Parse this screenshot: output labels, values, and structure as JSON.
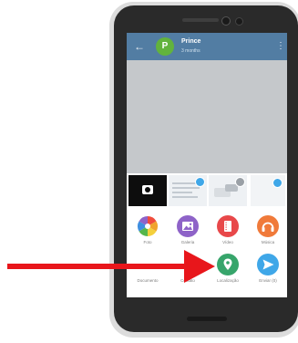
{
  "chat": {
    "name": "Prince",
    "status": "3 months"
  },
  "attach_menu": {
    "items": [
      {
        "label": "Foto",
        "icon": "photo-pinwheel-icon",
        "color": "#f0a32c"
      },
      {
        "label": "Galeria",
        "icon": "gallery-icon",
        "color": "#8e63c8"
      },
      {
        "label": "Vídeo",
        "icon": "video-icon",
        "color": "#e8484a"
      },
      {
        "label": "Música",
        "icon": "headphones-icon",
        "color": "#f07a3a"
      },
      {
        "label": "Documento",
        "icon": "file-icon",
        "color": "#7aa6d6"
      },
      {
        "label": "Contato",
        "icon": "contact-icon",
        "color": "#53bde1"
      },
      {
        "label": "Localização",
        "icon": "location-pin-icon",
        "color": "#37a56b"
      },
      {
        "label": "Enviar (0)",
        "icon": "send-icon",
        "color": "#3fa7e8"
      }
    ]
  },
  "colors": {
    "header": "#527da3",
    "avatar": "#62b33d",
    "arrow": "#e8161b"
  }
}
